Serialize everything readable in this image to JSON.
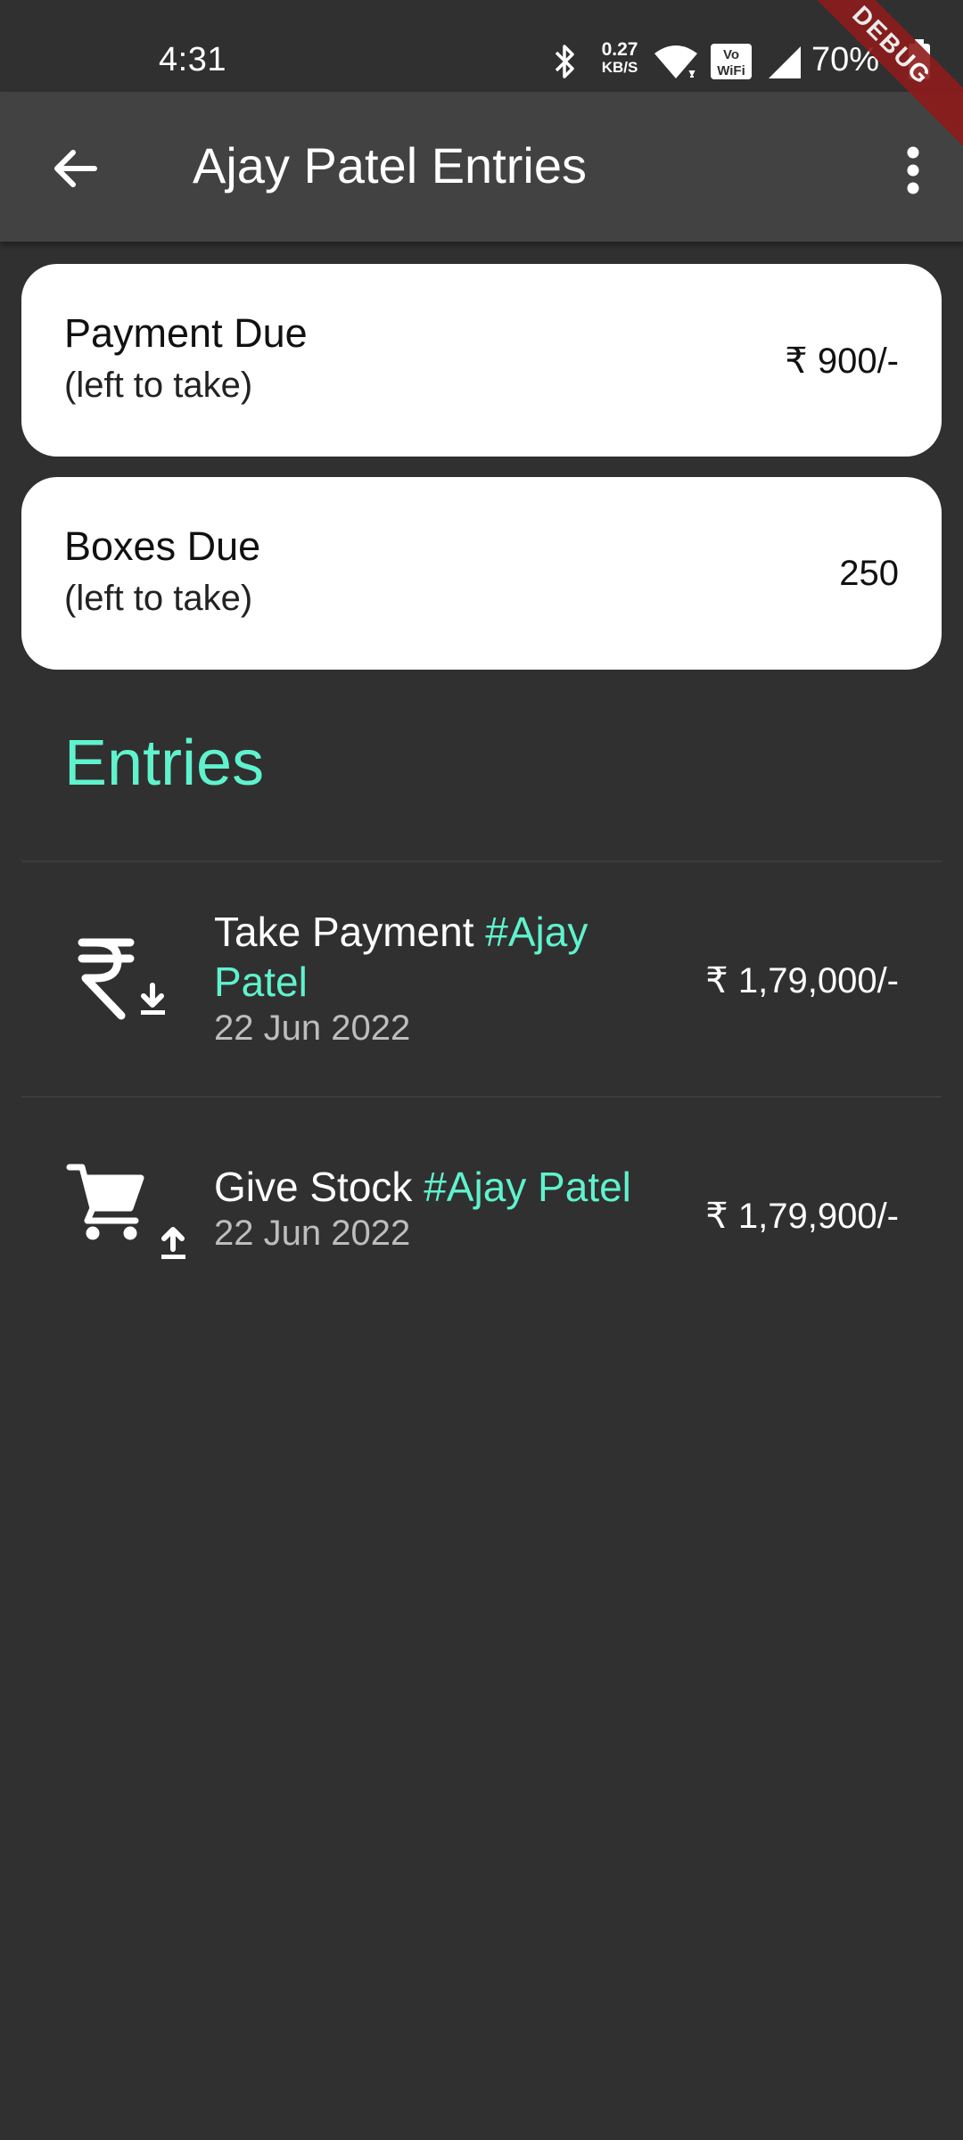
{
  "status_bar": {
    "time": "4:31",
    "net_speed_value": "0.27",
    "net_speed_unit": "KB/S",
    "battery": "70%",
    "icons": [
      "bluetooth-icon",
      "wifi-icon",
      "vowifi-icon",
      "signal-icon",
      "battery-icon"
    ]
  },
  "debug_banner": "DEBUG",
  "app_bar": {
    "title": "Ajay Patel Entries",
    "back_icon": "arrow-back-icon",
    "menu_icon": "more-vert-icon"
  },
  "summary": {
    "payment": {
      "title": "Payment Due",
      "subtitle": "(left to take)",
      "value": "₹ 900/-"
    },
    "boxes": {
      "title": "Boxes Due",
      "subtitle": "(left to take)",
      "value": "250"
    }
  },
  "entries_heading": "Entries",
  "entries": [
    {
      "icon": "rupee-download-icon",
      "title": "Take Payment",
      "tag": "#Ajay Patel",
      "date": "22 Jun 2022",
      "amount": "₹ 1,79,000/-"
    },
    {
      "icon": "cart-upload-icon",
      "title": "Give Stock",
      "tag": "#Ajay Patel",
      "date": "22 Jun 2022",
      "amount": "₹ 1,79,900/-"
    }
  ],
  "colors": {
    "background": "#303030",
    "app_bar": "#424242",
    "accent": "#5ff2cd",
    "card": "#ffffff"
  }
}
